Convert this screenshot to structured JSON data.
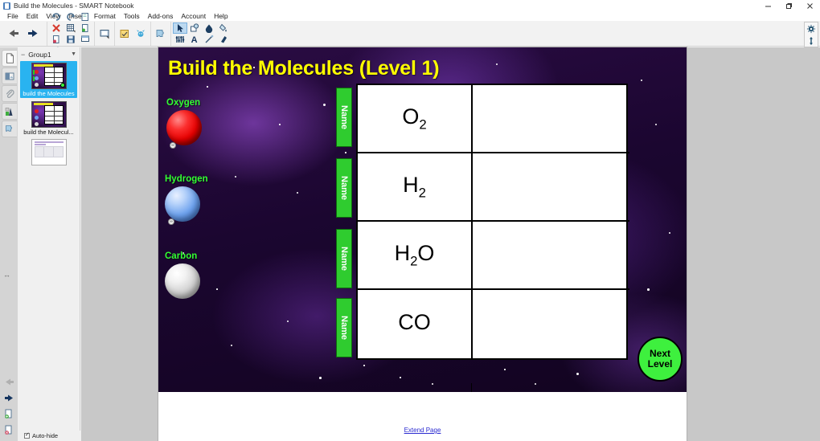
{
  "window": {
    "title": "Build the Molecules - SMART Notebook",
    "app_icon": "smart-notebook-icon",
    "minimize": "minimize-icon",
    "restore": "restore-icon",
    "close": "close-icon"
  },
  "menubar": {
    "items": [
      "File",
      "Edit",
      "View",
      "Insert",
      "Format",
      "Tools",
      "Add-ons",
      "Account",
      "Help"
    ]
  },
  "toolbar": {
    "nav": [
      {
        "name": "back-arrow-icon",
        "glyph": "←"
      },
      {
        "name": "forward-arrow-icon",
        "glyph": "→"
      }
    ],
    "file_group": [
      {
        "name": "undo-icon",
        "glyph": "↺"
      },
      {
        "name": "redo-icon",
        "glyph": "↻"
      },
      {
        "name": "new-page-icon",
        "glyph": "▣"
      },
      {
        "name": "delete-icon",
        "glyph": "✕"
      },
      {
        "name": "table-icon",
        "glyph": "▦"
      },
      {
        "name": "open-file-icon",
        "glyph": "▤"
      },
      {
        "name": "import-file-icon",
        "glyph": "▤"
      },
      {
        "name": "save-icon",
        "glyph": "▣"
      },
      {
        "name": "screen-shade-icon",
        "glyph": "▭"
      },
      {
        "name": "text-recognition-icon",
        "glyph": "A"
      }
    ],
    "view_group": [
      {
        "name": "full-screen-icon",
        "glyph": "▢"
      }
    ],
    "response_group": [
      {
        "name": "smart-response-icon",
        "glyph": "☑"
      },
      {
        "name": "smart-lab-icon",
        "glyph": "✸"
      }
    ],
    "addon_group": [
      {
        "name": "add-ons-icon",
        "glyph": "✦"
      }
    ],
    "tools_group": [
      {
        "name": "select-tool-icon",
        "glyph": "➤",
        "selected": true
      },
      {
        "name": "shapes-tool-icon",
        "glyph": "⬠"
      },
      {
        "name": "fill-tool-icon",
        "glyph": "⬤"
      },
      {
        "name": "paint-tool-icon",
        "glyph": "✒"
      },
      {
        "name": "properties-tool-icon",
        "glyph": "⫼"
      },
      {
        "name": "text-tool-icon",
        "glyph": "A"
      },
      {
        "name": "line-tool-icon",
        "glyph": "╱"
      },
      {
        "name": "eraser-tool-icon",
        "glyph": "◆"
      }
    ],
    "right": [
      {
        "name": "settings-gear-icon",
        "glyph": "⚙"
      },
      {
        "name": "move-toolbar-icon",
        "glyph": "⇕"
      }
    ]
  },
  "left_rail": {
    "tabs": [
      {
        "name": "page-sorter-tab",
        "icon": "page-icon",
        "active": true
      },
      {
        "name": "gallery-tab",
        "icon": "gallery-icon",
        "active": false
      },
      {
        "name": "attachments-tab",
        "icon": "paperclip-icon",
        "active": false
      },
      {
        "name": "add-ons-tab",
        "icon": "addons-icon",
        "active": false
      },
      {
        "name": "extensions-tab",
        "icon": "puzzle-icon",
        "active": false
      }
    ],
    "resize_handle": "sidebar-resize-icon",
    "bottom_tools": [
      {
        "name": "previous-page-icon",
        "glyph": "←"
      },
      {
        "name": "next-page-icon",
        "glyph": "→"
      },
      {
        "name": "add-page-icon",
        "glyph": "▤"
      },
      {
        "name": "delete-page-icon",
        "glyph": "▤"
      }
    ]
  },
  "sidebar": {
    "group_label": "Group1",
    "collapse_icon": "minus-icon",
    "menu_icon": "chevron-down-icon",
    "pages": [
      {
        "label": "build the Molecules",
        "selected": true
      },
      {
        "label": "build the Molecul...",
        "selected": false
      },
      {
        "label": "",
        "selected": false
      }
    ],
    "autohide_label": "Auto-hide",
    "autohide_checked": true
  },
  "slide": {
    "title": "Build the Molecules (Level 1)",
    "elements": [
      {
        "label": "Oxygen",
        "atom": "oxygen-atom",
        "color": "#e60000"
      },
      {
        "label": "Hydrogen",
        "atom": "hydrogen-atom",
        "color": "#6fa3ee"
      },
      {
        "label": "Carbon",
        "atom": "carbon-atom",
        "color": "#cfcfcf"
      }
    ],
    "name_tab_label": "Name",
    "table": {
      "rows": [
        {
          "formula_main": "O",
          "formula_sub": "2",
          "formula_tail": "",
          "answer": ""
        },
        {
          "formula_main": "H",
          "formula_sub": "2",
          "formula_tail": "",
          "answer": ""
        },
        {
          "formula_main": "H",
          "formula_sub": "2",
          "formula_tail": "O",
          "answer": ""
        },
        {
          "formula_main": "CO",
          "formula_sub": "",
          "formula_tail": "",
          "answer": ""
        }
      ]
    },
    "next_level_line1": "Next",
    "next_level_line2": "Level"
  },
  "page": {
    "extend_page": "Extend Page"
  }
}
